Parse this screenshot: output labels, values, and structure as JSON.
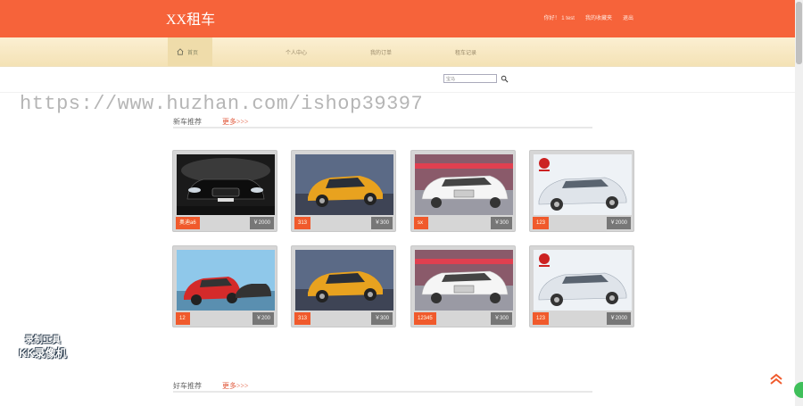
{
  "header": {
    "brand": "XX租车",
    "links": [
      "你好！ 1 test",
      "我的收藏夹",
      "退出"
    ]
  },
  "nav": {
    "home": "首页",
    "items": [
      "个人中心",
      "我的订单",
      "租车记录"
    ]
  },
  "search": {
    "value": "宝马"
  },
  "watermark": "https://www.huzhan.com/ishop39397",
  "sections": [
    {
      "title": "新车推荐",
      "more": "更多>>>"
    },
    {
      "title": "好车推荐",
      "more": "更多>>>"
    }
  ],
  "cars": [
    {
      "name": "奥迪a6",
      "price": "￥2000",
      "model": "black-sedan"
    },
    {
      "name": "313",
      "price": "￥300",
      "model": "yellow-coupe"
    },
    {
      "name": "sx",
      "price": "￥300",
      "model": "white-sedan"
    },
    {
      "name": "123",
      "price": "￥2000",
      "model": "silver-sedan"
    },
    {
      "name": "12",
      "price": "￥200",
      "model": "red-sedan"
    },
    {
      "name": "313",
      "price": "￥300",
      "model": "yellow-coupe"
    },
    {
      "name": "12345",
      "price": "￥300",
      "model": "white-sedan"
    },
    {
      "name": "123",
      "price": "￥2000",
      "model": "silver-sedan"
    }
  ],
  "recorder": {
    "line1": "录制工具",
    "line2": "KK录像机"
  },
  "colors": {
    "primary": "#f6633a",
    "nav_bg": "#fbefd2",
    "badge": "#f05a2c",
    "price_bg": "#777777"
  },
  "icons": {
    "home": "home-icon",
    "search": "search-icon",
    "back_to_top": "double-chevron-up-icon"
  }
}
